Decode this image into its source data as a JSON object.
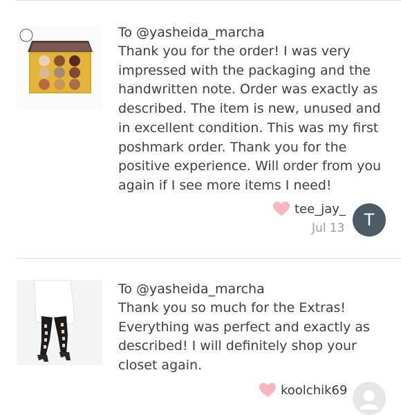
{
  "reviews": [
    {
      "to": "To @yasheida_marcha",
      "lines": [
        "Thank you for the order! I was very",
        "impressed with the packaging and the",
        "handwritten note. Order was exactly as",
        "described. The item is new, unused and",
        "in excellent condition. This was my first",
        "poshmark order. Thank you for the",
        "positive experience. Will order from you",
        "again if I see more items I need!"
      ],
      "username": "tee_jay_",
      "date": "Jul 13",
      "avatar_letter": "T",
      "avatar_color": "#4c5b66",
      "heart_color": "#f7b6c0",
      "thumb_icon": "eyeshadow-palette-image"
    },
    {
      "to": "To @yasheida_marcha",
      "lines": [
        "Thank you so much for the Extras!",
        "Everything was perfect and exactly as",
        "described! I will definitely shop your",
        "closet again."
      ],
      "username": "koolchik69",
      "heart_color": "#f7b6c0",
      "avatar_color": "#e6e6e6",
      "thumb_icon": "cutout-leggings-image"
    }
  ]
}
